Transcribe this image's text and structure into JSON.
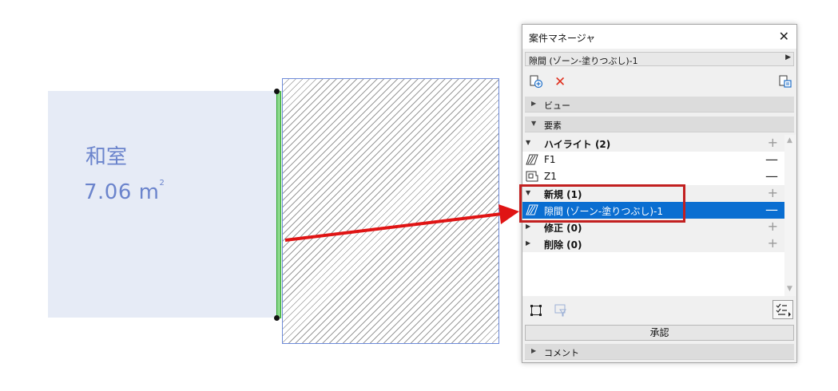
{
  "drawing": {
    "room_name": "和室",
    "room_area_value": "7.06 m",
    "room_area_unit_sup": "2"
  },
  "panel": {
    "title": "案件マネージャ",
    "selector_value": "隙間 (ゾーン-塗りつぶし)-1",
    "sections": {
      "view": "ビュー",
      "elements": "要素",
      "comment": "コメント"
    },
    "groups": {
      "highlight": "ハイライト (2)",
      "new": "新規 (1)",
      "modify": "修正 (0)",
      "delete": "削除 (0)"
    },
    "items": {
      "f1": "F1",
      "z1": "Z1",
      "gap": "隙間 (ゾーン-塗りつぶし)-1"
    },
    "approve_label": "承認",
    "plus_symbol": "+",
    "minus_symbol": "—",
    "close_symbol": "✕",
    "delete_symbol": "✕"
  },
  "colors": {
    "selection": "#0a6ed1",
    "annotation_red": "#c22020",
    "room_fill": "#e6ebf6",
    "room_text": "#6b84cc",
    "gap_line": "#8bd98b"
  }
}
